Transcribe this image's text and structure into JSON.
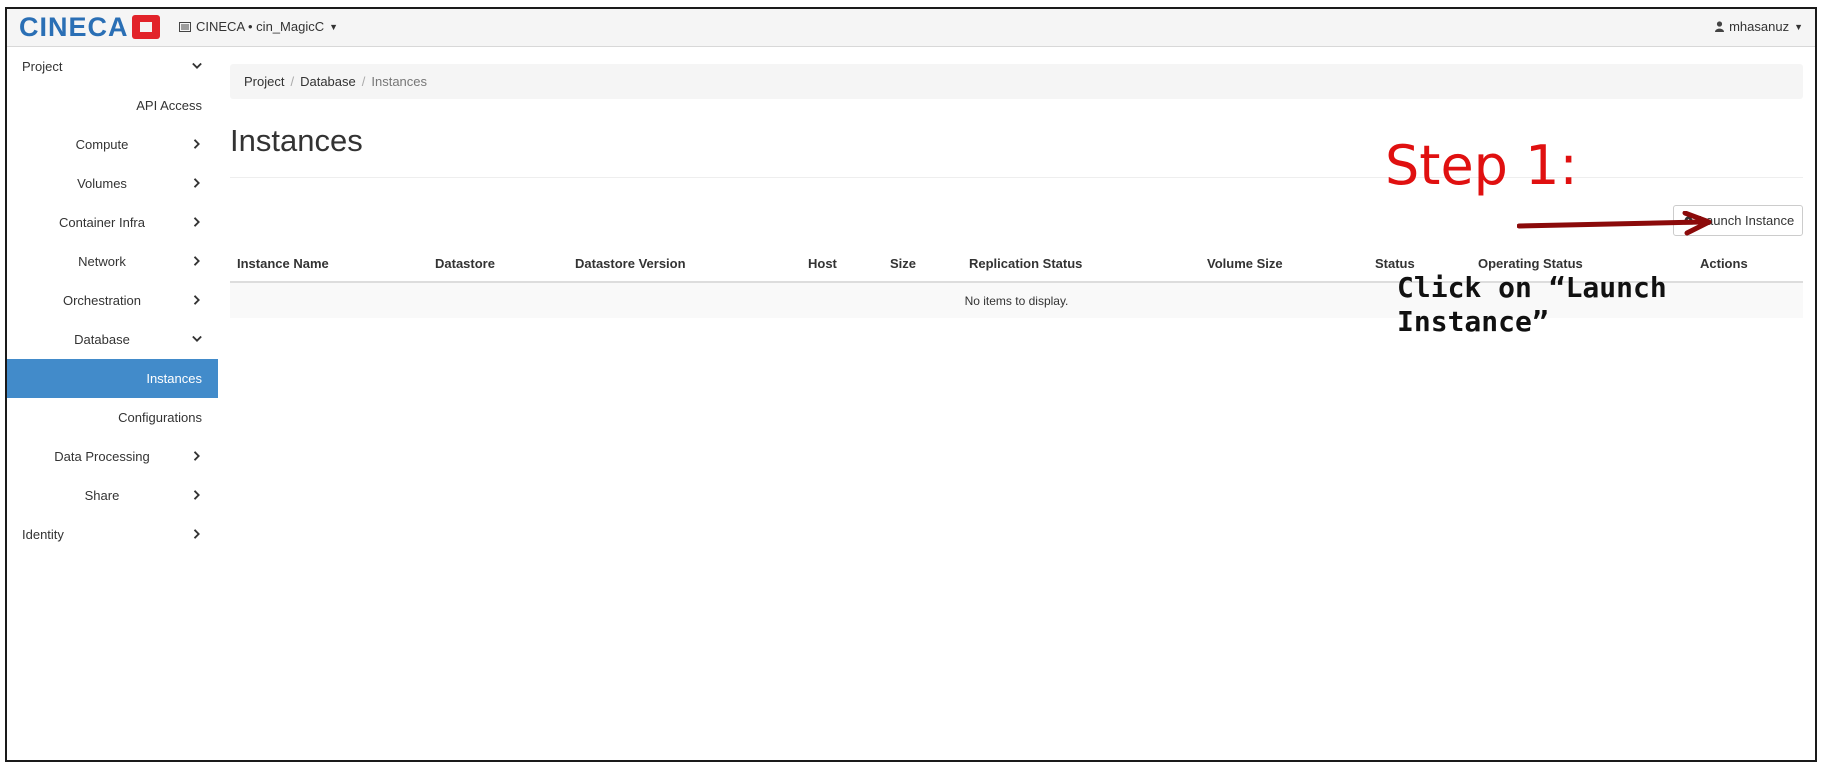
{
  "navbar": {
    "logo_text": "CINECA",
    "project_switcher": "CINECA • cin_MagicC",
    "user": "mhasanuz",
    "icons": {
      "project": "list-icon",
      "user": "user-icon",
      "caret": "caret-down-icon"
    }
  },
  "sidebar": {
    "items": [
      {
        "label": "Project",
        "level": 0,
        "chevron": "down"
      },
      {
        "label": "API Access",
        "level": 1,
        "align": "right"
      },
      {
        "label": "Compute",
        "level": 1,
        "chevron": "right"
      },
      {
        "label": "Volumes",
        "level": 1,
        "chevron": "right"
      },
      {
        "label": "Container Infra",
        "level": 1,
        "chevron": "right"
      },
      {
        "label": "Network",
        "level": 1,
        "chevron": "right"
      },
      {
        "label": "Orchestration",
        "level": 1,
        "chevron": "right"
      },
      {
        "label": "Database",
        "level": 1,
        "chevron": "down"
      },
      {
        "label": "Instances",
        "level": 2,
        "active": true
      },
      {
        "label": "Configurations",
        "level": 2
      },
      {
        "label": "Data Processing",
        "level": 1,
        "chevron": "right"
      },
      {
        "label": "Share",
        "level": 1,
        "chevron": "right"
      },
      {
        "label": "Identity",
        "level": 0,
        "chevron": "right"
      }
    ],
    "active_color": "#428bca"
  },
  "breadcrumb": {
    "items": [
      "Project",
      "Database",
      "Instances"
    ]
  },
  "page": {
    "title": "Instances"
  },
  "toolbar": {
    "launch_label": "Launch Instance",
    "launch_icon": "cloud-upload-icon"
  },
  "table": {
    "columns": [
      "Instance Name",
      "Datastore",
      "Datastore Version",
      "Host",
      "Size",
      "Replication Status",
      "Volume Size",
      "Status",
      "Operating Status",
      "Actions"
    ],
    "empty_message": "No items to display."
  },
  "annotation": {
    "title": "Step 1:",
    "text_line1": "Click on “Launch",
    "text_line2": "Instance”",
    "title_color": "#e01010",
    "arrow_color": "#8b0a0a"
  }
}
